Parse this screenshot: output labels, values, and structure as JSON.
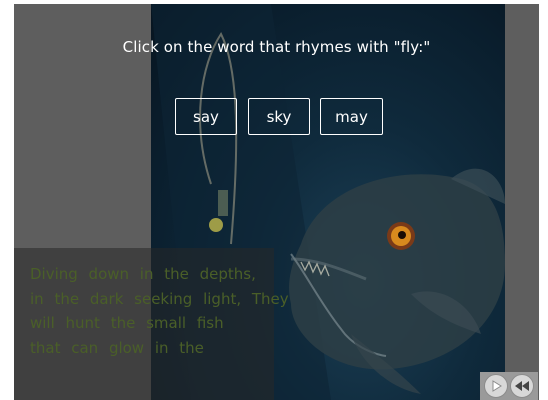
{
  "question": "Click on the word that rhymes with \"fly:\"",
  "choices": [
    "say",
    "sky",
    "may"
  ],
  "story_lines": [
    "Diving down in the depths,",
    "in the dark seeking light, They",
    "will hunt the small fish",
    "that can glow in the"
  ],
  "controls": {
    "play_icon": "play-icon",
    "rewind_icon": "rewind-icon"
  },
  "colors": {
    "panel_gray": "#5e5e5e",
    "story_text": "#4a5f28",
    "water": "#0f2a3c"
  }
}
